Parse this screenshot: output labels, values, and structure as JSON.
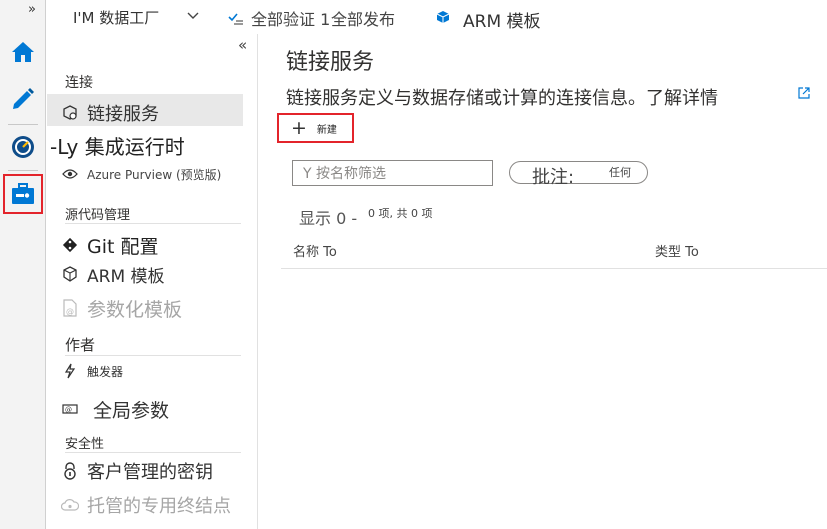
{
  "topbar": {
    "expand_glyph": "»",
    "factory_name": "I'M 数据工厂",
    "validate_all": "全部验证 1",
    "publish_all": "全部发布",
    "arm_template": "ARM 模板",
    "icons": {
      "validate": "validate-icon",
      "arm": "arm-template-icon",
      "dropdown": "chevron-down-icon"
    }
  },
  "rail": {
    "items": [
      {
        "name": "home",
        "icon": "home-icon"
      },
      {
        "name": "author",
        "icon": "pencil-icon"
      },
      {
        "name": "monitor",
        "icon": "gauge-icon"
      },
      {
        "name": "manage",
        "icon": "toolbox-icon",
        "active": true
      }
    ],
    "active_color": "#e3242b",
    "accent": "#0078d4"
  },
  "sidebar": {
    "collapse_glyph": "«",
    "sections": [
      {
        "heading": "连接",
        "items": [
          {
            "label": "链接服务",
            "icon": "linked-service-icon",
            "selected": true
          },
          {
            "label": "-Ly 集成运行时",
            "icon": ""
          },
          {
            "label": "Azure Purview (预览版)",
            "icon": "eye-icon"
          }
        ]
      },
      {
        "heading": "源代码管理",
        "items": [
          {
            "label": "Git 配置",
            "icon": "git-icon"
          },
          {
            "label": "ARM 模板",
            "icon": "arm-template-icon"
          },
          {
            "label": "参数化模板",
            "icon": "parameterized-template-icon",
            "disabled": true
          }
        ]
      },
      {
        "heading": "作者",
        "items": [
          {
            "label": "触发器",
            "icon": "trigger-icon"
          },
          {
            "label": "全局参数",
            "icon": "global-parameter-icon"
          }
        ]
      },
      {
        "heading": "安全性",
        "items": [
          {
            "label": "客户管理的密钥",
            "icon": "key-lock-icon"
          },
          {
            "label": "托管的专用终结点",
            "icon": "cloud-endpoint-icon",
            "disabled": true
          }
        ]
      }
    ]
  },
  "main": {
    "title": "链接服务",
    "description": "链接服务定义与数据存储或计算的连接信息。了解详情",
    "new_button": {
      "plus": "+",
      "label": "新建"
    },
    "filter_placeholder": "Y 按名称筛选",
    "annotation_filter": {
      "key": "批注:",
      "value": "任何"
    },
    "showing": "显示 0 -",
    "showing_count": "0 项, 共 0 项",
    "columns": [
      "名称 To",
      "类型 To"
    ]
  }
}
